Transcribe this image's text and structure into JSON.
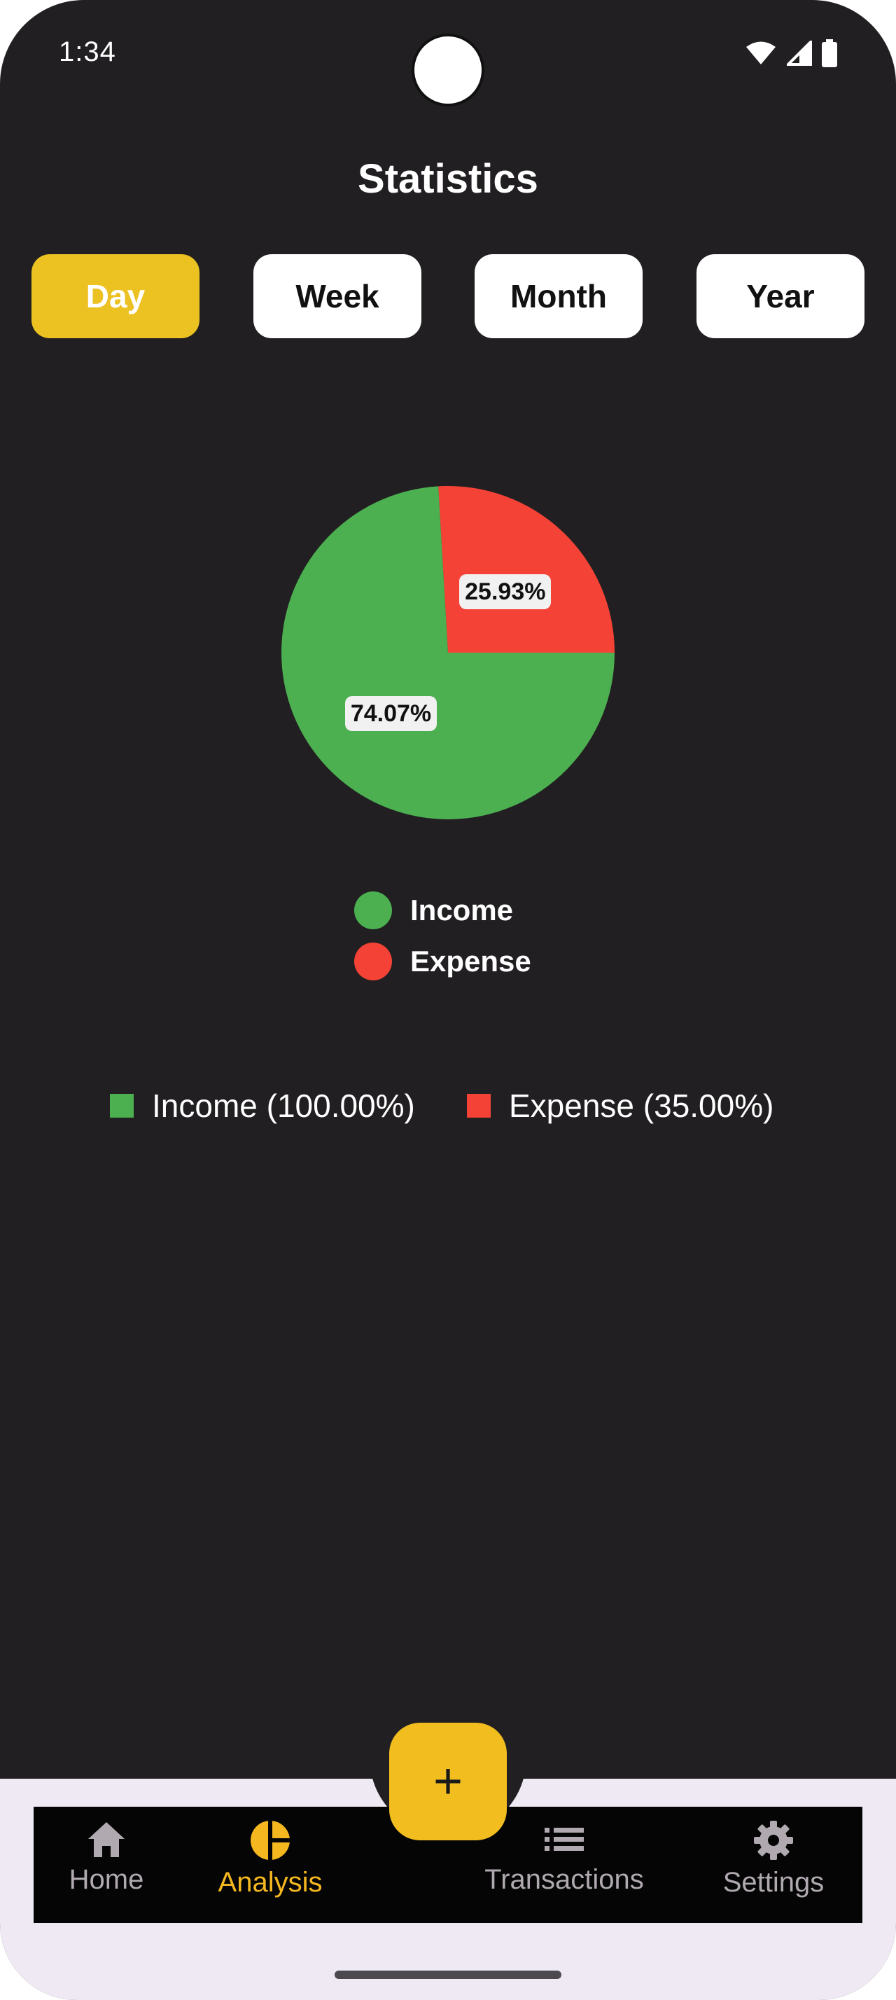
{
  "status_bar": {
    "time": "1:34"
  },
  "header": {
    "title": "Statistics"
  },
  "tabs": [
    {
      "label": "Day",
      "active": true
    },
    {
      "label": "Week",
      "active": false
    },
    {
      "label": "Month",
      "active": false
    },
    {
      "label": "Year",
      "active": false
    }
  ],
  "chart_data": {
    "type": "pie",
    "slices": [
      {
        "name": "Income",
        "value": 74.07,
        "label": "74.07%",
        "color": "#4caf50"
      },
      {
        "name": "Expense",
        "value": 25.93,
        "label": "25.93%",
        "color": "#f44336"
      }
    ],
    "legend": [
      "Income",
      "Expense"
    ]
  },
  "summary": {
    "income": {
      "label": "Income (100.00%)",
      "color": "#4caf50"
    },
    "expense": {
      "label": "Expense (35.00%)",
      "color": "#f44336"
    }
  },
  "fab": {
    "label": "+"
  },
  "bottom_nav": {
    "items": [
      {
        "label": "Home",
        "icon": "home-icon",
        "active": false
      },
      {
        "label": "Analysis",
        "icon": "pie-chart-icon",
        "active": true
      },
      {
        "label": "Transactions",
        "icon": "list-icon",
        "active": false
      },
      {
        "label": "Settings",
        "icon": "gear-icon",
        "active": false
      }
    ]
  },
  "colors": {
    "background": "#211f21",
    "accent": "#ecc223",
    "income": "#4caf50",
    "expense": "#f44336"
  }
}
